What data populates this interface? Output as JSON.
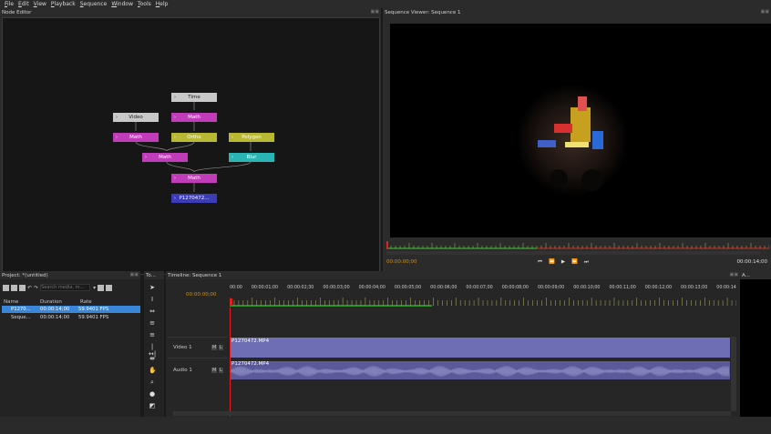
{
  "menu": [
    "File",
    "Edit",
    "View",
    "Playback",
    "Sequence",
    "Window",
    "Tools",
    "Help"
  ],
  "node_editor": {
    "title": "Node Editor",
    "nodes": [
      {
        "id": "time",
        "label": "Time",
        "color": "#c8c8c8"
      },
      {
        "id": "video",
        "label": "Video",
        "color": "#c8c8c8"
      },
      {
        "id": "math1",
        "label": "Math",
        "color": "#c03cb8"
      },
      {
        "id": "math2",
        "label": "Math",
        "color": "#c03cb8"
      },
      {
        "id": "ortho",
        "label": "Ortho",
        "color": "#b8b832"
      },
      {
        "id": "polygon",
        "label": "Polygon",
        "color": "#b8b832"
      },
      {
        "id": "math3",
        "label": "Math",
        "color": "#c03cb8"
      },
      {
        "id": "blur",
        "label": "Blur",
        "color": "#2ab4b4"
      },
      {
        "id": "math4",
        "label": "Math",
        "color": "#c03cb8"
      },
      {
        "id": "output",
        "label": "P1270472...",
        "color": "#3c3cb8"
      }
    ]
  },
  "viewer": {
    "title": "Sequence Viewer: Sequence 1",
    "current_time": "00:00:00;00",
    "end_time": "00:00:14;00"
  },
  "project": {
    "title": "Project: *(untitled)",
    "search_placeholder": "Search media, m...",
    "columns": [
      "Name",
      "Duration",
      "Rate"
    ],
    "rows": [
      {
        "name": "P1270...",
        "duration": "00:00:14;00",
        "rate": "59.9401 FPS",
        "selected": true
      },
      {
        "name": "Seque...",
        "duration": "00:00:14;00",
        "rate": "59.9401 FPS",
        "selected": false
      }
    ]
  },
  "tools_title": "To...",
  "timeline": {
    "title": "Timeline: Sequence 1",
    "timecode": "00:00:00;00",
    "ruler": [
      "00:00",
      "00:00:01;00",
      "00:00:02;30",
      "00:00:03;00",
      "00:00:04;00",
      "00:00:05;00",
      "00:00:06;00",
      "00:00:07;00",
      "00:00:08;00",
      "00:00:09;00",
      "00:00:10;00",
      "00:00:11;00",
      "00:00:12;00",
      "00:00:13;00",
      "00:00:14"
    ],
    "tracks": [
      {
        "name": "Video 1",
        "clip": "P1270472.MP4"
      },
      {
        "name": "Audio 1",
        "clip": "P1270472.MP4"
      }
    ],
    "track_buttons": [
      "M",
      "L"
    ]
  },
  "right_panel_title": "A...",
  "colors": {
    "playhead": "#e02020",
    "ruler_green": "#2bd62b",
    "clip": "#6e6eb4"
  }
}
